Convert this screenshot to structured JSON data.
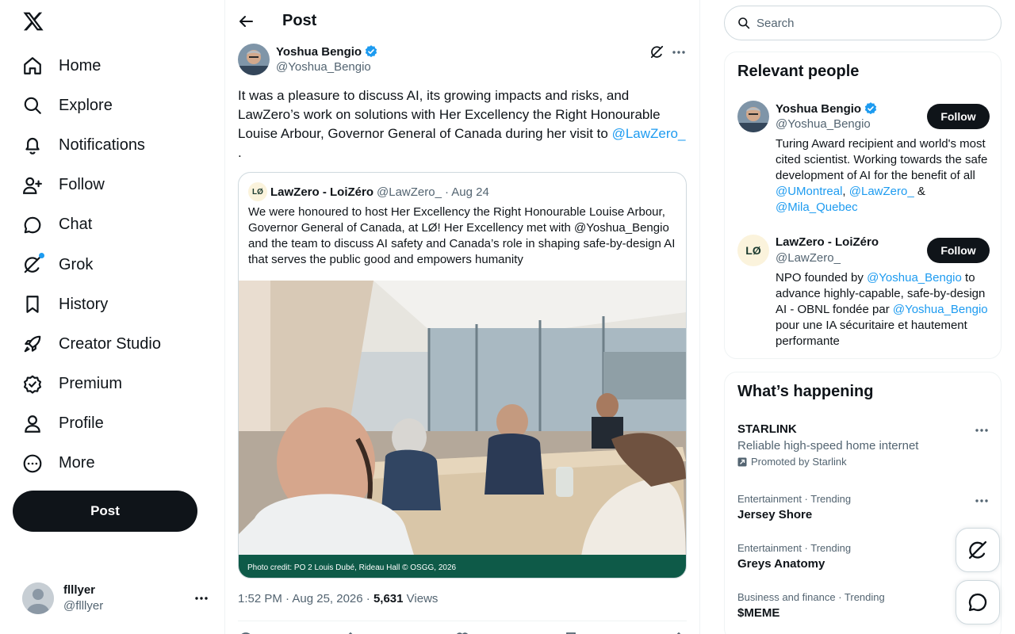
{
  "colors": {
    "accent": "#1d9bf0",
    "text": "#0f1419",
    "secondary": "#536471",
    "button": "#0f1419"
  },
  "nav": {
    "items": [
      {
        "label": "Home",
        "icon": "home-icon"
      },
      {
        "label": "Explore",
        "icon": "search-icon"
      },
      {
        "label": "Notifications",
        "icon": "bell-icon"
      },
      {
        "label": "Follow",
        "icon": "person-plus-icon"
      },
      {
        "label": "Chat",
        "icon": "chat-bubble-icon"
      },
      {
        "label": "Grok",
        "icon": "grok-icon"
      },
      {
        "label": "History",
        "icon": "bookmark-icon"
      },
      {
        "label": "Creator Studio",
        "icon": "rocket-icon"
      },
      {
        "label": "Premium",
        "icon": "verified-badge-icon"
      },
      {
        "label": "Profile",
        "icon": "person-icon"
      },
      {
        "label": "More",
        "icon": "more-circle-icon"
      }
    ],
    "post_label": "Post"
  },
  "account": {
    "name": "flllyer",
    "handle": "@flllyer"
  },
  "header": {
    "title": "Post"
  },
  "post": {
    "author_name": "Yoshua Bengio",
    "author_handle": "@Yoshua_Bengio",
    "text_main": "It was a pleasure to discuss AI, its growing impacts and risks, and LawZero’s work on solutions with Her Excellency the Right Honourable Louise Arbour, Governor General of Canada during her visit to ",
    "text_mention": "@LawZero_",
    "text_tail": " .",
    "time": "1:52 PM · Aug 25, 2026 · ",
    "views_count": "5,631",
    "views_label": " Views",
    "quote": {
      "avatar_text": "LØ",
      "name": "LawZero - LoiZéro",
      "handle": "@LawZero_",
      "date": "· Aug 24",
      "text": "We were honoured to host Her Excellency the Right Honourable Louise Arbour, Governor General of Canada, at LØ! Her Excellency met with @Yoshua_Bengio and the team to discuss AI safety and Canada’s role in shaping safe-by-design AI that serves the public good and empowers humanity",
      "photo_credit": "Photo credit: PO 2 Louis Dubé, Rideau Hall © OSGG, 2026"
    }
  },
  "search": {
    "placeholder": "Search"
  },
  "relevant": {
    "title": "Relevant people",
    "people": [
      {
        "name": "Yoshua Bengio",
        "handle": "@Yoshua_Bengio",
        "follow": "Follow",
        "bio_1": "Turing Award recipient and world's most cited scientist. Working towards the safe development of AI for the benefit of all ",
        "bio_m1": "@UMontreal",
        "bio_2": ", ",
        "bio_m2": "@LawZero_",
        "bio_3": " & ",
        "bio_m3": "@Mila_Quebec"
      },
      {
        "name": "LawZero - LoiZéro",
        "handle": "@LawZero_",
        "avatar_text": "LØ",
        "follow": "Follow",
        "bio_1": "NPO founded by ",
        "bio_m1": "@Yoshua_Bengio",
        "bio_2": " to advance highly-capable, safe-by-design AI - OBNL fondée par ",
        "bio_m2": "@Yoshua_Bengio",
        "bio_3": " pour une IA sécuritaire et hautement performante"
      }
    ]
  },
  "happening": {
    "title": "What’s happening",
    "promo": {
      "name": "STARLINK",
      "desc": "Reliable high-speed home internet",
      "by": "Promoted by Starlink"
    },
    "trends": [
      {
        "category": "Entertainment · Trending",
        "title": "Jersey Shore"
      },
      {
        "category": "Entertainment · Trending",
        "title": "Greys Anatomy"
      },
      {
        "category": "Business and finance · Trending",
        "title": "$MEME"
      }
    ]
  }
}
